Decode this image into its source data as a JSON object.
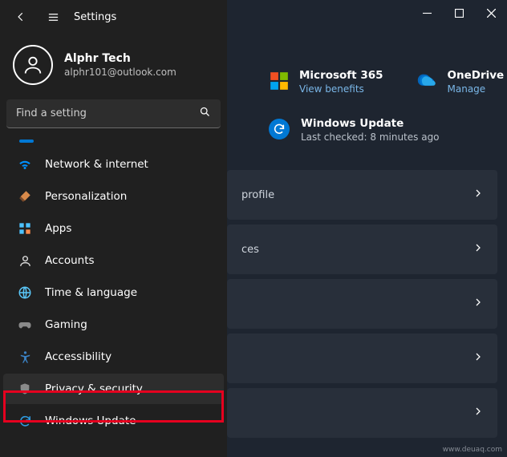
{
  "titlebar": {
    "title": "Settings"
  },
  "user": {
    "name": "Alphr Tech",
    "email": "alphr101@outlook.com"
  },
  "search": {
    "placeholder": "Find a setting"
  },
  "nav": [
    {
      "label": "Network & internet",
      "icon": "wifi"
    },
    {
      "label": "Personalization",
      "icon": "brush"
    },
    {
      "label": "Apps",
      "icon": "apps"
    },
    {
      "label": "Accounts",
      "icon": "person"
    },
    {
      "label": "Time & language",
      "icon": "globe-clock"
    },
    {
      "label": "Gaming",
      "icon": "gamepad"
    },
    {
      "label": "Accessibility",
      "icon": "accessibility"
    },
    {
      "label": "Privacy & security",
      "icon": "shield",
      "selected": true
    },
    {
      "label": "Windows Update",
      "icon": "sync"
    }
  ],
  "promos": {
    "m365": {
      "title": "Microsoft 365",
      "sub": "View benefits"
    },
    "onedrive": {
      "title": "OneDrive",
      "sub": "Manage"
    }
  },
  "update": {
    "title": "Windows Update",
    "sub": "Last checked: 8 minutes ago"
  },
  "cards": [
    {
      "label": "profile"
    },
    {
      "label": "ces"
    },
    {
      "label": ""
    },
    {
      "label": ""
    },
    {
      "label": ""
    }
  ],
  "watermark": "www.deuaq.com"
}
